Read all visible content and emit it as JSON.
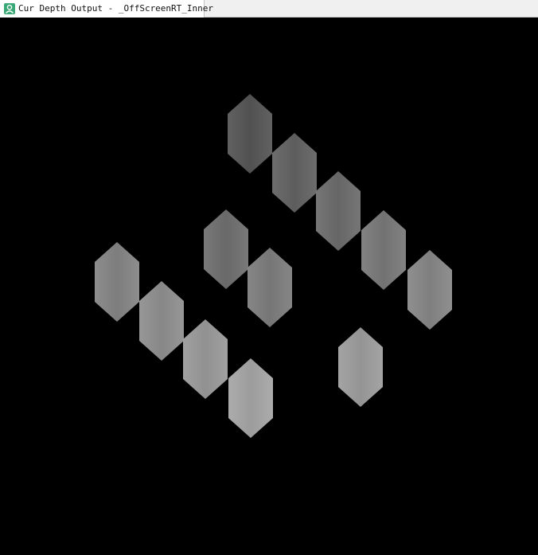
{
  "window": {
    "tab_title": "Cur Depth Output - _OffScreenRT_Inner",
    "tab_icon": "render-target-icon",
    "accent_color": "#3aa776"
  },
  "viewport": {
    "background_color": "#000000",
    "shape_icon": "hexagon",
    "shapes": [
      {
        "name": "hexagon-1",
        "shade": "#575757"
      },
      {
        "name": "hexagon-2",
        "shade": "#636363"
      },
      {
        "name": "hexagon-3",
        "shade": "#6c6c6c"
      },
      {
        "name": "hexagon-4",
        "shade": "#787878"
      },
      {
        "name": "hexagon-5",
        "shade": "#858585"
      },
      {
        "name": "hexagon-6",
        "shade": "#6f6f6f"
      },
      {
        "name": "hexagon-7",
        "shade": "#7c7c7c"
      },
      {
        "name": "hexagon-8",
        "shade": "#838383"
      },
      {
        "name": "hexagon-9",
        "shade": "#8d8d8d"
      },
      {
        "name": "hexagon-10",
        "shade": "#979797"
      },
      {
        "name": "hexagon-11",
        "shade": "#a2a2a2"
      },
      {
        "name": "hexagon-12",
        "shade": "#9a9a9a"
      }
    ]
  }
}
